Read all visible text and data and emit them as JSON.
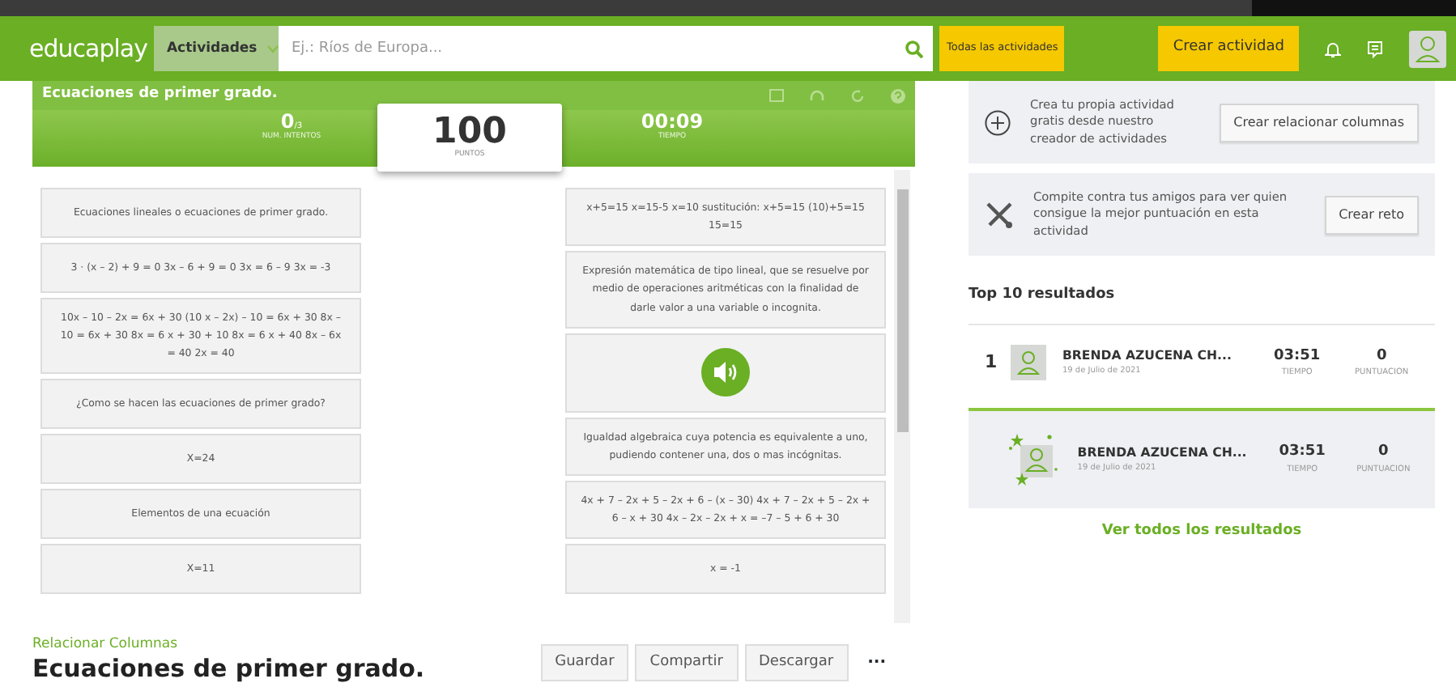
{
  "navbar": {
    "logo": "educaplay",
    "category": "Actividades",
    "search_placeholder": "Ej.: Ríos de Europa...",
    "all_button": "Todas las actividades",
    "create_button": "Crear actividad"
  },
  "game": {
    "title": "Ecuaciones de primer grado.",
    "attempts": {
      "value": "0",
      "total": "/3",
      "label": "NUM. INTENTOS"
    },
    "points": {
      "value": "100",
      "label": "PUNTOS"
    },
    "time": {
      "value": "00:09",
      "label": "TIEMPO"
    },
    "left_cards": [
      {
        "kind": "text",
        "text": "Ecuaciones lineales o ecuaciones de primer grado."
      },
      {
        "kind": "text",
        "text": "3 · (x – 2) + 9 = 0 3x – 6 + 9 = 0 3x = 6 – 9 3x = -3"
      },
      {
        "kind": "text",
        "text": "10x – 10 – 2x = 6x + 30 (10 x – 2x) – 10 = 6x + 30 8x – 10 = 6x + 30 8x = 6 x + 30 + 10 8x = 6 x + 40 8x – 6x = 40 2x = 40"
      },
      {
        "kind": "text",
        "text": "¿Como se hacen las ecuaciones de primer grado?"
      },
      {
        "kind": "text",
        "text": "X=24"
      },
      {
        "kind": "text",
        "text": "Elementos de una ecuación"
      },
      {
        "kind": "text",
        "text": "X=11"
      }
    ],
    "right_cards": [
      {
        "kind": "text",
        "text": "x+5=15 x=15-5 x=10 sustitución: x+5=15 (10)+5=15 15=15"
      },
      {
        "kind": "text",
        "text": "Expresión matemática de tipo lineal, que se resuelve por medio de operaciones aritméticas con la finalidad de darle valor a una variable o incognita."
      },
      {
        "kind": "audio"
      },
      {
        "kind": "text",
        "text": "Igualdad algebraica cuya potencia es equivalente a uno, pudiendo contener una, dos o mas incógnitas."
      },
      {
        "kind": "text",
        "text": "4x + 7 – 2x + 5 – 2x + 6 – (x – 30) 4x + 7 – 2x + 5 – 2x + 6 – x + 30 4x – 2x – 2x + x = –7 – 5 + 6 + 30"
      },
      {
        "kind": "text",
        "text": "x = -1"
      }
    ]
  },
  "footer": {
    "type": "Relacionar Columnas",
    "title": "Ecuaciones de primer grado.",
    "buttons": [
      "Guardar",
      "Compartir",
      "Descargar"
    ],
    "more": "···"
  },
  "promos": [
    {
      "kind": "create",
      "text": "Crea tu propia actividad gratis desde nuestro creador de actividades",
      "button": "Crear relacionar columnas"
    },
    {
      "kind": "challenge",
      "text": "Compite contra tus amigos para ver quien consigue la mejor puntuación en esta actividad",
      "button": "Crear reto"
    }
  ],
  "results": {
    "title": "Top 10 resultados",
    "rows": [
      {
        "rank": "1",
        "name": "BRENDA AZUCENA CH...",
        "date": "19 de Julio de 2021",
        "time": "03:51",
        "time_label": "TIEMPO",
        "score": "0",
        "score_label": "PUNTUACION",
        "selected": false
      },
      {
        "name": "BRENDA AZUCENA CH...",
        "date": "19 de Julio de 2021",
        "time": "03:51",
        "time_label": "TIEMPO",
        "score": "0",
        "score_label": "PUNTUACION",
        "selected": true
      }
    ],
    "link": "Ver todos los resultados"
  }
}
